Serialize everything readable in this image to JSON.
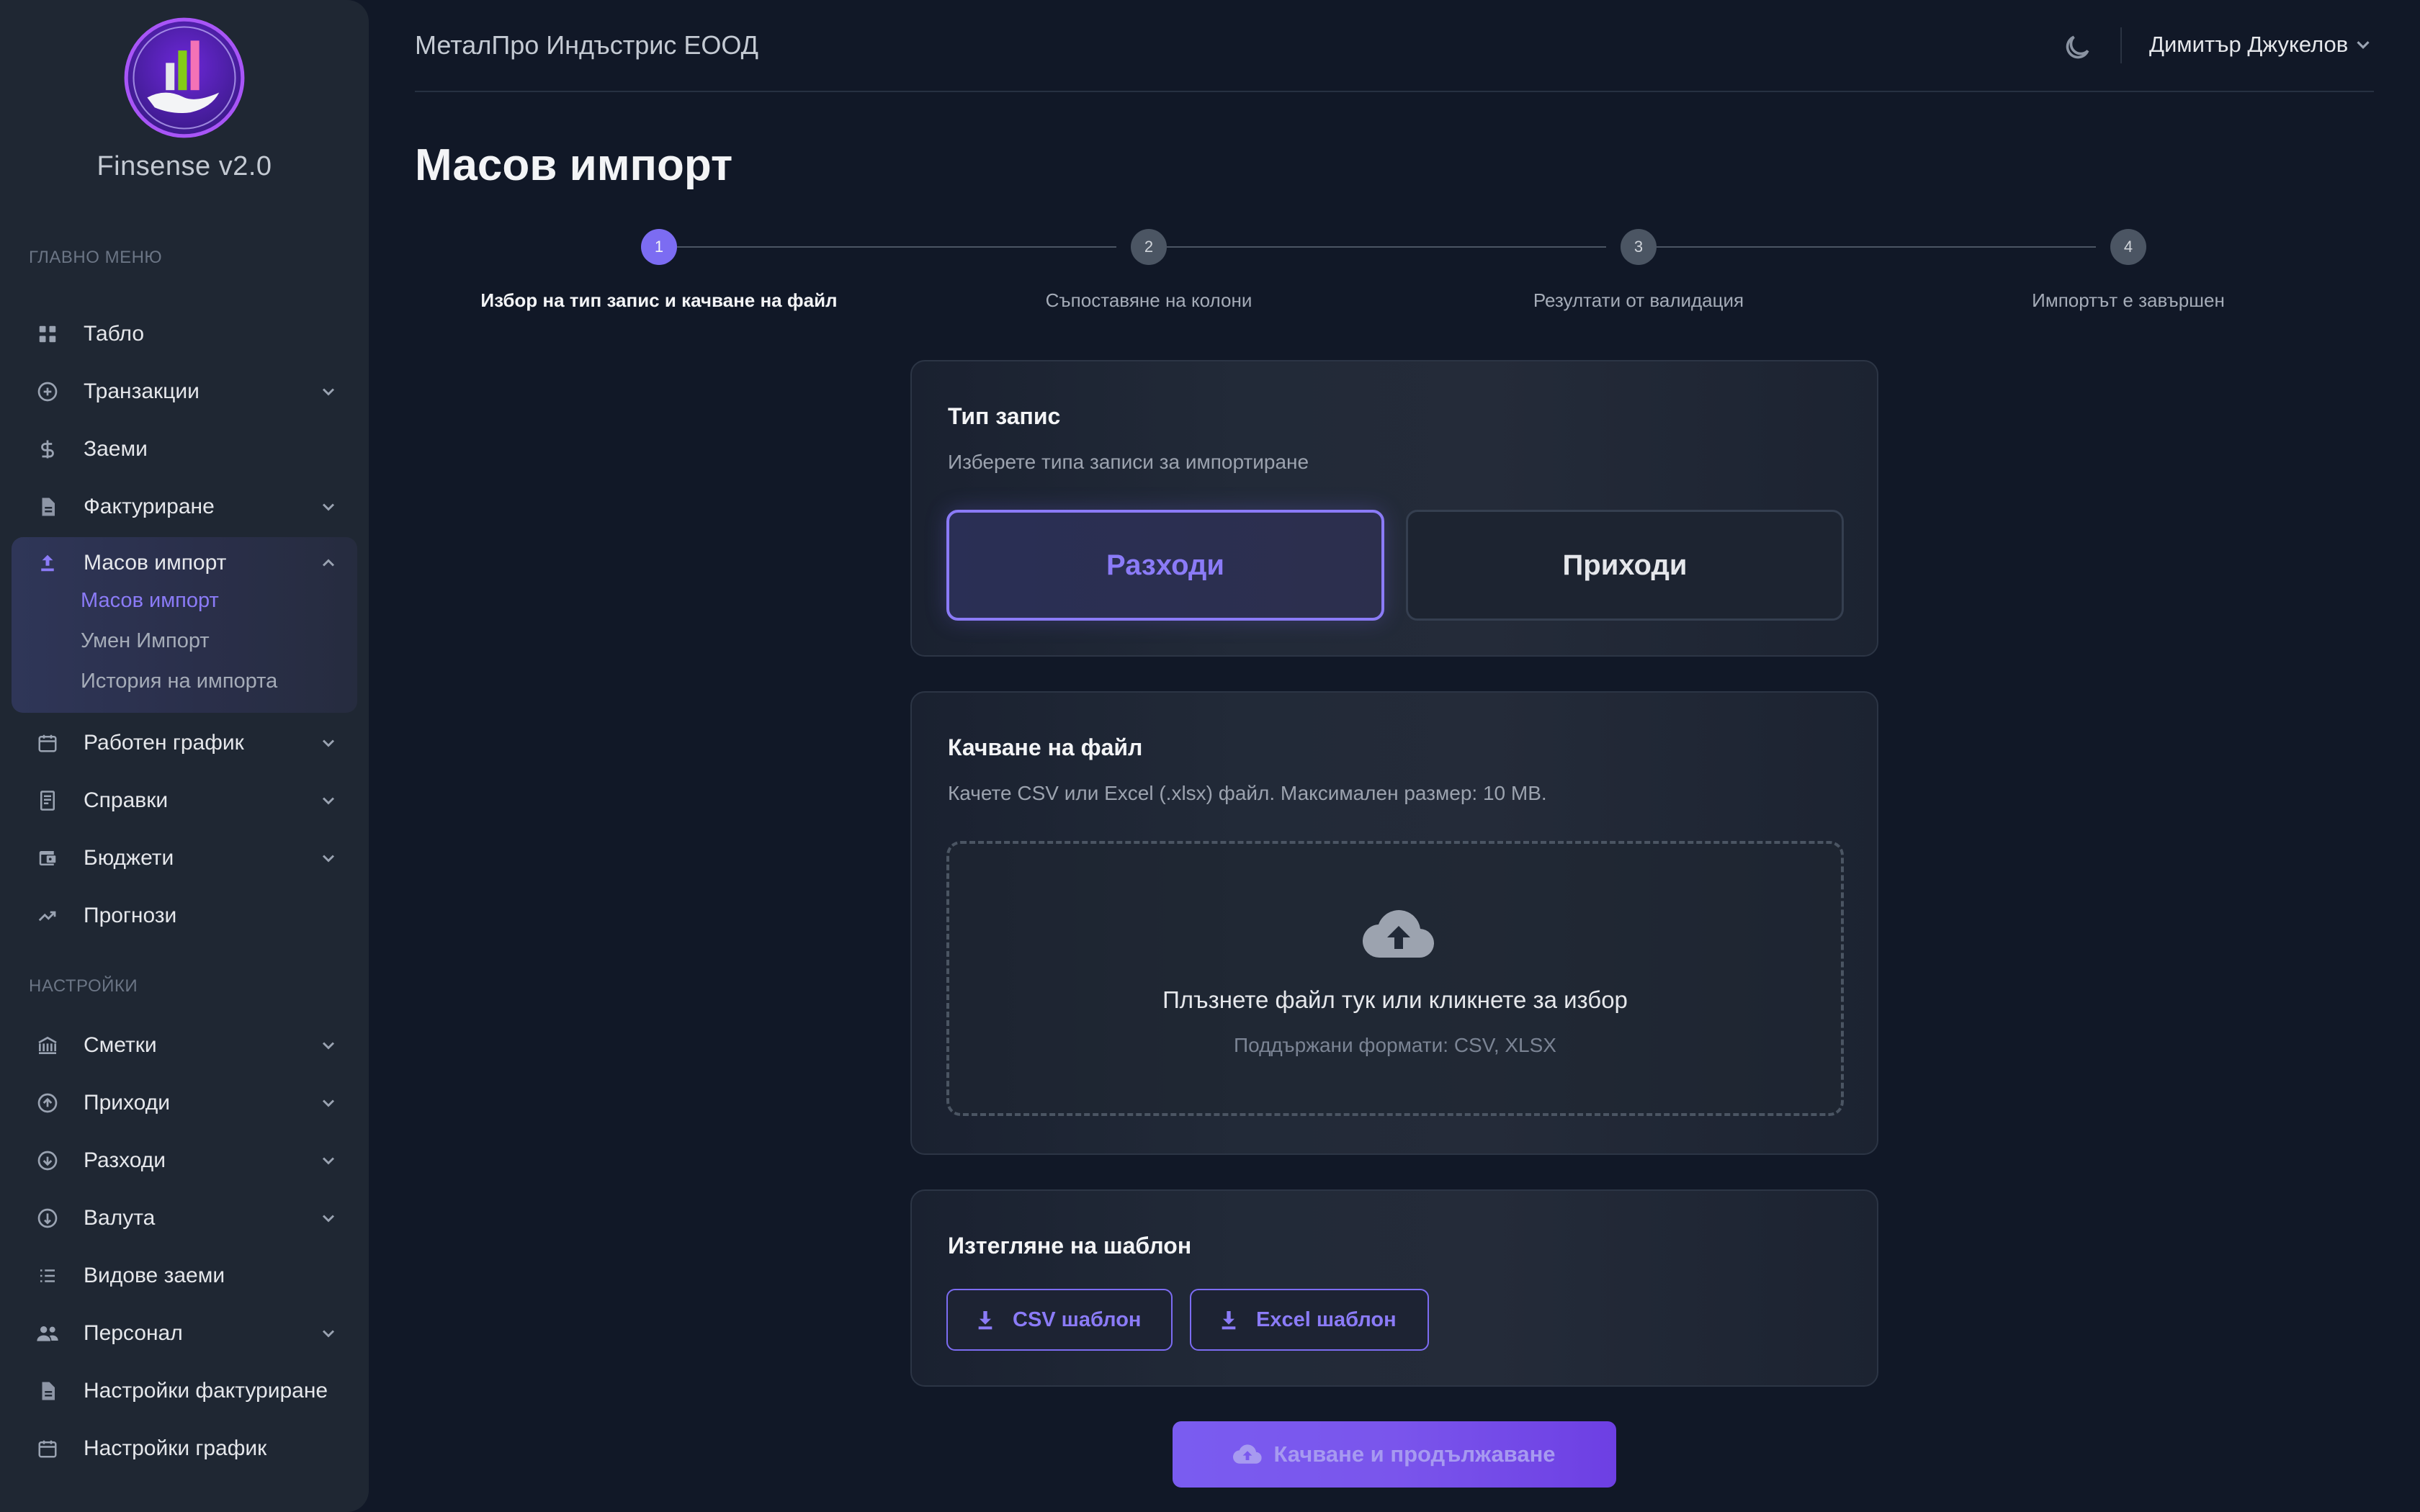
{
  "app": {
    "name": "Finsense v2.0",
    "company": "МеталПро Индъстрис ЕООД",
    "user": "Димитър Джукелов"
  },
  "sidebar": {
    "main_label": "ГЛАВНО МЕНЮ",
    "settings_label": "НАСТРОЙКИ",
    "items": [
      {
        "label": "Табло",
        "icon": "grid-icon"
      },
      {
        "label": "Транзакции",
        "icon": "plus-circle-icon",
        "chevron": true
      },
      {
        "label": "Заеми",
        "icon": "dollar-icon"
      },
      {
        "label": "Фактуриране",
        "icon": "document-icon",
        "chevron": true
      },
      {
        "label": "Масов импорт",
        "icon": "upload-icon",
        "expanded": true,
        "children": [
          "Масов импорт",
          "Умен Импорт",
          "История на импорта"
        ],
        "active_child": 0
      },
      {
        "label": "Работен график",
        "icon": "calendar-icon",
        "chevron": true
      },
      {
        "label": "Справки",
        "icon": "receipt-icon",
        "chevron": true
      },
      {
        "label": "Бюджети",
        "icon": "wallet-icon",
        "chevron": true
      },
      {
        "label": "Прогнози",
        "icon": "trending-up-icon"
      }
    ],
    "settings_items": [
      {
        "label": "Сметки",
        "icon": "bank-icon",
        "chevron": true
      },
      {
        "label": "Приходи",
        "icon": "arrow-up-circle-icon",
        "chevron": true
      },
      {
        "label": "Разходи",
        "icon": "arrow-down-circle-icon",
        "chevron": true
      },
      {
        "label": "Валута",
        "icon": "currency-circle-icon",
        "chevron": true
      },
      {
        "label": "Видове заеми",
        "icon": "list-icon"
      },
      {
        "label": "Персонал",
        "icon": "people-icon",
        "chevron": true
      },
      {
        "label": "Настройки фактуриране",
        "icon": "document-icon"
      },
      {
        "label": "Настройки график",
        "icon": "calendar-icon"
      }
    ]
  },
  "page": {
    "title": "Масов импорт",
    "steps": [
      {
        "number": "1",
        "label": "Избор на тип запис и качване на файл",
        "active": true
      },
      {
        "number": "2",
        "label": "Съпоставяне на колони",
        "active": false
      },
      {
        "number": "3",
        "label": "Резултати от валидация",
        "active": false
      },
      {
        "number": "4",
        "label": "Импортът е завършен",
        "active": false
      }
    ]
  },
  "record_type": {
    "title": "Тип запис",
    "description": "Изберете типа записи за импортиране",
    "options": [
      "Разходи",
      "Приходи"
    ],
    "selected": "Разходи"
  },
  "upload": {
    "title": "Качване на файл",
    "description": "Качете CSV или Excel (.xlsx) файл. Максимален размер: 10 MB.",
    "drop_text": "Плъзнете файл тук или кликнете за избор",
    "formats_text": "Поддържани формати: CSV, XLSX"
  },
  "template": {
    "title": "Изтегляне на шаблон",
    "csv_label": "CSV шаблон",
    "excel_label": "Excel шаблон"
  },
  "submit": {
    "label": "Качване и продължаване"
  },
  "colors": {
    "accent": "#7c6cf2",
    "background": "#111827",
    "sidebar": "#1f2733",
    "card": "#222a38"
  }
}
